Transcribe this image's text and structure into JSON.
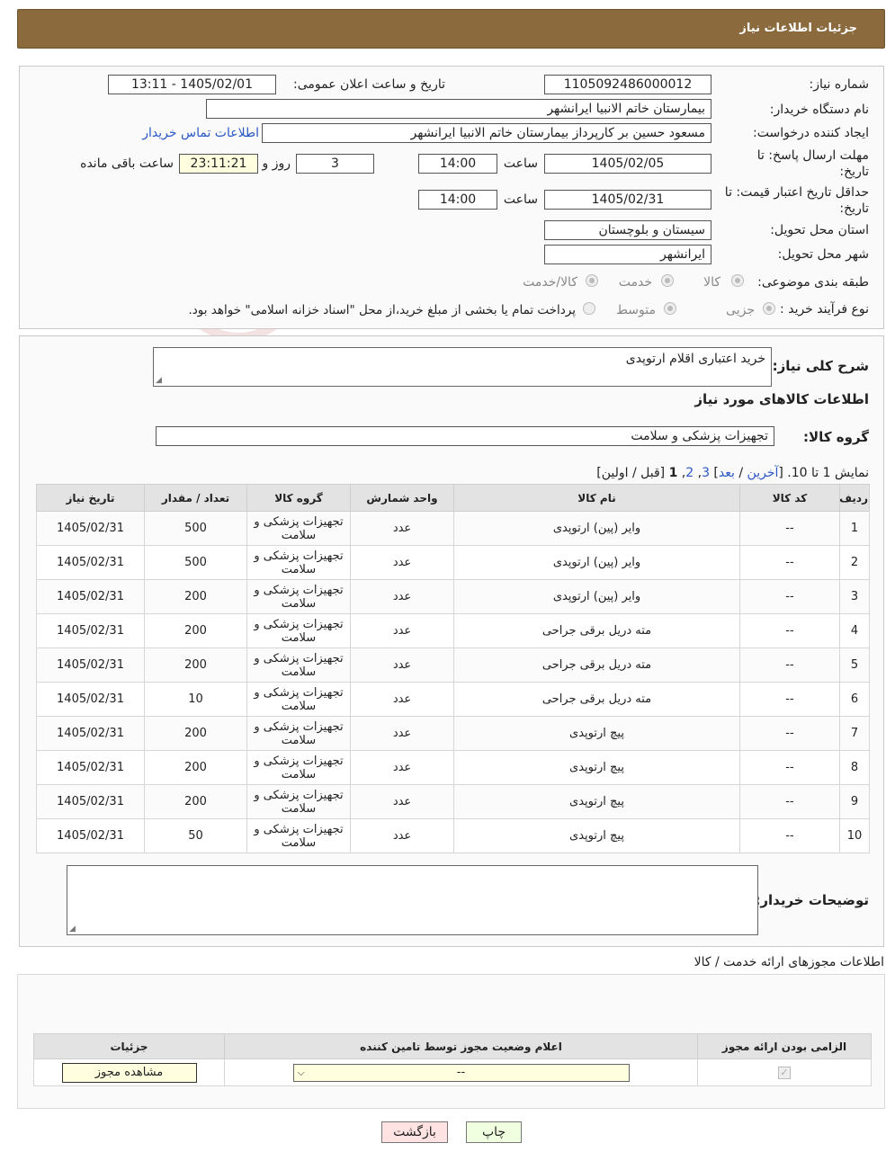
{
  "header": {
    "title": "جزئیات اطلاعات نیاز"
  },
  "watermark": {
    "text": "AriaTender.neT"
  },
  "info": {
    "need_number_label": "شماره نیاز:",
    "need_number": "1105092486000012",
    "announce_label": "تاریخ و ساعت اعلان عمومی:",
    "announce_value": "1405/02/01 - 13:11",
    "buyer_org_label": "نام دستگاه خریدار:",
    "buyer_org": "بیمارستان خاتم الانبیا ایرانشهر",
    "creator_label": "ایجاد کننده درخواست:",
    "creator": "مسعود حسین بر کارپرداز بیمارستان خاتم الانبیا ایرانشهر",
    "contact_link": "اطلاعات تماس خریدار",
    "deadline_label_1": "مهلت ارسال پاسخ: تا",
    "deadline_label_2": "تاریخ:",
    "deadline_date": "1405/02/05",
    "time_label": "ساعت",
    "deadline_time": "14:00",
    "days_value": "3",
    "days_label": "روز و",
    "remaining_time": "23:11:21",
    "remaining_label": "ساعت باقی مانده",
    "validity_label_1": "حداقل تاریخ اعتبار قیمت: تا",
    "validity_label_2": "تاریخ:",
    "validity_date": "1405/02/31",
    "validity_time": "14:00",
    "province_label": "استان محل تحویل:",
    "province": "سیستان و بلوچستان",
    "city_label": "شهر محل تحویل:",
    "city": "ایرانشهر",
    "category_label": "طبقه بندی موضوعی:",
    "category_options": [
      "کالا",
      "خدمت",
      "کالا/خدمت"
    ],
    "process_label": "نوع فرآیند خرید :",
    "process_options": [
      "جزیی",
      "متوسط"
    ],
    "process_note": "پرداخت تمام یا بخشی از مبلغ خرید،از محل \"اسناد خزانه اسلامی\" خواهد بود."
  },
  "details": {
    "summary_label": "شرح کلی نیاز:",
    "summary_value": "خرید اعتباری اقلام ارتوپدی",
    "goods_info_title": "اطلاعات کالاهای مورد نیاز",
    "goods_group_label": "گروه کالا:",
    "goods_group_value": "تجهیزات پزشکی و سلامت",
    "pager_text": "نمایش 1 تا 10. [",
    "pager_last": "آخرین",
    "pager_sep": " / ",
    "pager_next": "بعد",
    "pager_p3": "3",
    "pager_p2": "2",
    "pager_p1": "1",
    "pager_tail": "[قبل / اولین]",
    "columns": [
      "ردیف",
      "کد کالا",
      "نام کالا",
      "واحد شمارش",
      "گروه کالا",
      "تعداد / مقدار",
      "تاریخ نیاز"
    ],
    "rows": [
      {
        "n": "1",
        "code": "--",
        "name": "وایر (پین) ارتوپدی",
        "unit": "عدد",
        "group": "تجهیزات پزشکی و سلامت",
        "qty": "500",
        "date": "1405/02/31"
      },
      {
        "n": "2",
        "code": "--",
        "name": "وایر (پین) ارتوپدی",
        "unit": "عدد",
        "group": "تجهیزات پزشکی و سلامت",
        "qty": "500",
        "date": "1405/02/31"
      },
      {
        "n": "3",
        "code": "--",
        "name": "وایر (پین) ارتوپدی",
        "unit": "عدد",
        "group": "تجهیزات پزشکی و سلامت",
        "qty": "200",
        "date": "1405/02/31"
      },
      {
        "n": "4",
        "code": "--",
        "name": "مته دریل برقی جراحی",
        "unit": "عدد",
        "group": "تجهیزات پزشکی و سلامت",
        "qty": "200",
        "date": "1405/02/31"
      },
      {
        "n": "5",
        "code": "--",
        "name": "مته دریل برقی جراحی",
        "unit": "عدد",
        "group": "تجهیزات پزشکی و سلامت",
        "qty": "200",
        "date": "1405/02/31"
      },
      {
        "n": "6",
        "code": "--",
        "name": "مته دریل برقی جراحی",
        "unit": "عدد",
        "group": "تجهیزات پزشکی و سلامت",
        "qty": "10",
        "date": "1405/02/31"
      },
      {
        "n": "7",
        "code": "--",
        "name": "پیچ ارتوپدی",
        "unit": "عدد",
        "group": "تجهیزات پزشکی و سلامت",
        "qty": "200",
        "date": "1405/02/31"
      },
      {
        "n": "8",
        "code": "--",
        "name": "پیچ ارتوپدی",
        "unit": "عدد",
        "group": "تجهیزات پزشکی و سلامت",
        "qty": "200",
        "date": "1405/02/31"
      },
      {
        "n": "9",
        "code": "--",
        "name": "پیچ ارتوپدی",
        "unit": "عدد",
        "group": "تجهیزات پزشکی و سلامت",
        "qty": "200",
        "date": "1405/02/31"
      },
      {
        "n": "10",
        "code": "--",
        "name": "پیچ ارتوپدی",
        "unit": "عدد",
        "group": "تجهیزات پزشکی و سلامت",
        "qty": "50",
        "date": "1405/02/31"
      }
    ],
    "buyer_notes_label": "توضیحات خریدار:",
    "buyer_notes_value": ""
  },
  "permits": {
    "title": "اطلاعات مجوزهای ارائه خدمت / کالا",
    "columns": [
      "الزامی بودن ارائه مجوز",
      "اعلام وضعیت مجوز توسط تامین کننده",
      "جزئیات"
    ],
    "select_value": "--",
    "view_button": "مشاهده مجوز"
  },
  "actions": {
    "print": "چاپ",
    "back": "بازگشت"
  }
}
